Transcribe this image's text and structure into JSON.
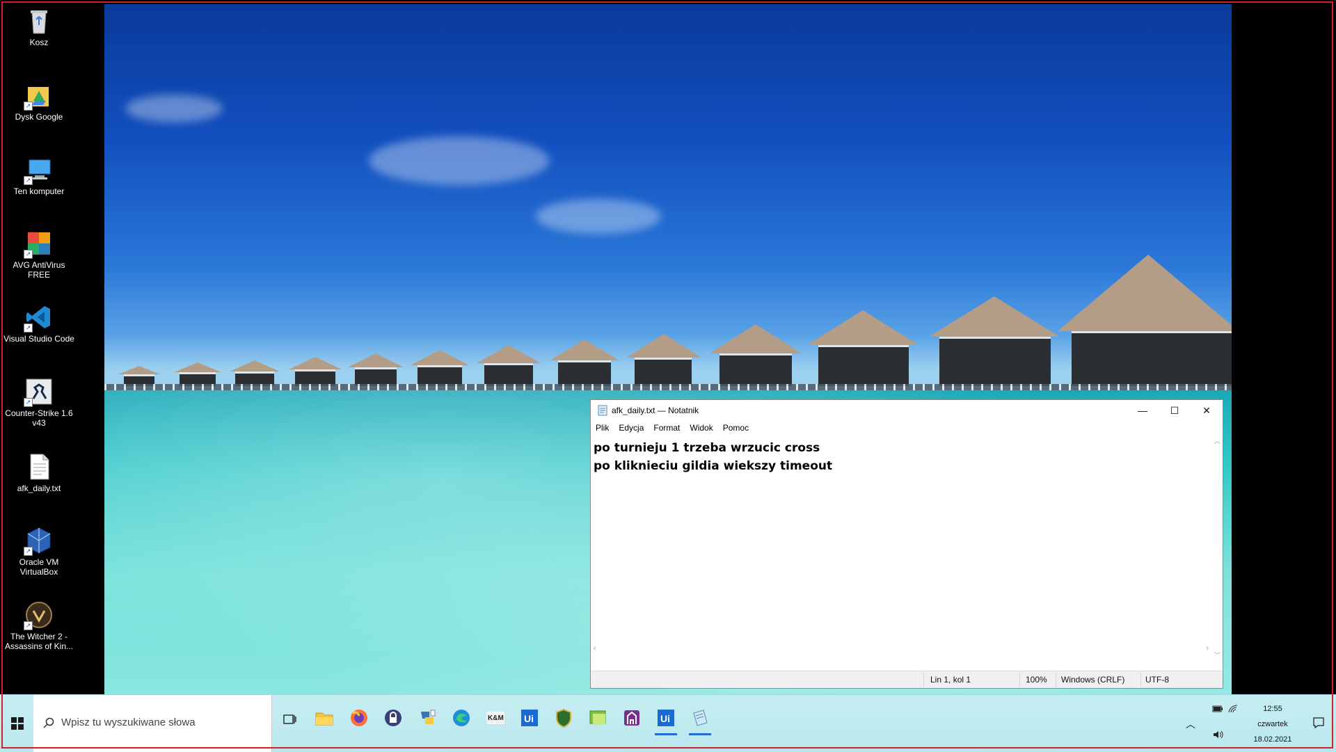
{
  "desktop": {
    "icons": [
      {
        "label": "Kosz",
        "icon": "recycle-bin-icon"
      },
      {
        "label": "Dysk Google",
        "icon": "google-drive-icon"
      },
      {
        "label": "Ten komputer",
        "icon": "computer-icon"
      },
      {
        "label": "AVG AntiVirus FREE",
        "icon": "avg-antivirus-icon"
      },
      {
        "label": "Visual Studio Code",
        "icon": "vscode-icon"
      },
      {
        "label": "Counter-Strike 1.6 v43",
        "icon": "counter-strike-icon"
      },
      {
        "label": "afk_daily.txt",
        "icon": "text-file-icon"
      },
      {
        "label": "Oracle VM VirtualBox",
        "icon": "virtualbox-icon"
      },
      {
        "label": "The Witcher 2 - Assassins of Kin...",
        "icon": "witcher-icon"
      }
    ]
  },
  "notepad": {
    "title": "afk_daily.txt — Notatnik",
    "menu": [
      "Plik",
      "Edycja",
      "Format",
      "Widok",
      "Pomoc"
    ],
    "lines": [
      "po turnieju 1 trzeba wrzucic cross",
      "po kliknieciu gildia wiekszy timeout"
    ],
    "status": {
      "position": "Lin 1, kol 1",
      "zoom": "100%",
      "line_ending": "Windows (CRLF)",
      "encoding": "UTF-8"
    }
  },
  "taskbar": {
    "search_placeholder": "Wpisz tu wyszukiwane słowa",
    "apps": [
      "file-explorer-icon",
      "firefox-icon",
      "lock-app-icon",
      "python-icon",
      "edge-icon",
      "kam-icon",
      "uipath-icon",
      "shield-game-icon",
      "image-viewer-icon",
      "app-icon",
      "uipath-studio-icon",
      "notepad-icon"
    ],
    "clock": {
      "time": "12:55",
      "day": "czwartek",
      "date": "18.02.2021"
    }
  },
  "colors": {
    "accent": "#1e6ad8",
    "border": "#d42020",
    "taskbar": "#c6eef2"
  }
}
